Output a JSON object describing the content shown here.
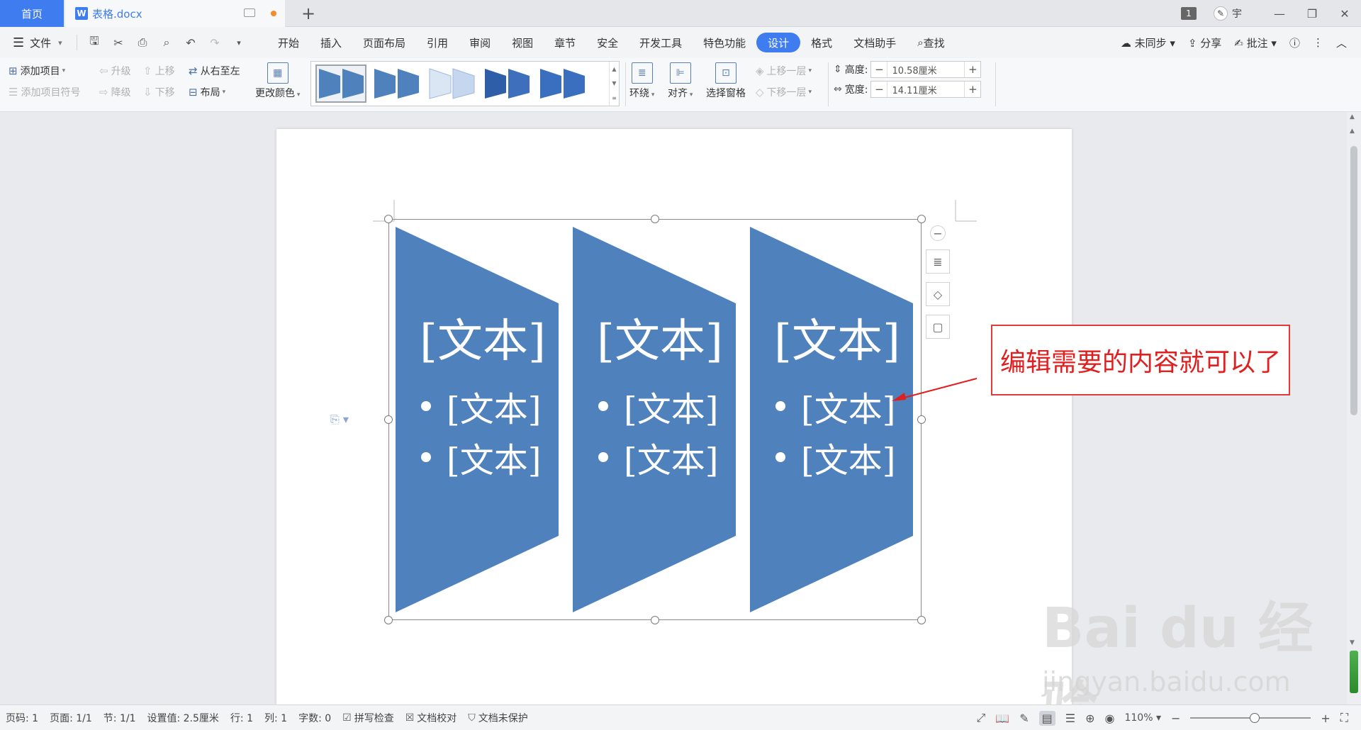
{
  "tabs": {
    "home": "首页",
    "document": "表格.docx"
  },
  "titlebar": {
    "badge": "1",
    "user": "宇"
  },
  "menubar": {
    "file": "文件",
    "items": [
      "开始",
      "插入",
      "页面布局",
      "引用",
      "审阅",
      "视图",
      "章节",
      "安全",
      "开发工具",
      "特色功能",
      "设计",
      "格式",
      "文档助手",
      "查找"
    ],
    "active": "设计",
    "right": {
      "sync": "未同步",
      "share": "分享",
      "comment": "批注"
    }
  },
  "ribbon": {
    "add_item": "添加项目",
    "add_bullet": "添加项目符号",
    "promote": "升级",
    "demote": "降级",
    "move_up": "上移",
    "move_down": "下移",
    "rtl": "从右至左",
    "layout": "布局",
    "change_color": "更改颜色",
    "wrap": "环绕",
    "align": "对齐",
    "select_pane": "选择窗格",
    "bring_forward": "上移一层",
    "send_backward": "下移一层",
    "height_label": "高度:",
    "height_value": "10.58厘米",
    "width_label": "宽度:",
    "width_value": "14.11厘米"
  },
  "smartart": {
    "fill_color": "#4f81bd",
    "shapes": [
      {
        "title": "[文本]",
        "bullets": [
          "[文本]",
          "[文本]"
        ]
      },
      {
        "title": "[文本]",
        "bullets": [
          "[文本]",
          "[文本]"
        ]
      },
      {
        "title": "[文本]",
        "bullets": [
          "[文本]",
          "[文本]"
        ]
      }
    ]
  },
  "annotation": {
    "text": "编辑需要的内容就可以了",
    "color": "#e02020"
  },
  "watermark": {
    "main": "Bai du 经验",
    "sub": "jingyan.baidu.com"
  },
  "statusbar": {
    "page_code": "页码: 1",
    "pages": "页面: 1/1",
    "section": "节: 1/1",
    "setting": "设置值: 2.5厘米",
    "row": "行: 1",
    "col": "列: 1",
    "word_count": "字数: 0",
    "spell_check": "拼写检查",
    "doc_check": "文档校对",
    "protect": "文档未保护",
    "zoom": "110%"
  }
}
